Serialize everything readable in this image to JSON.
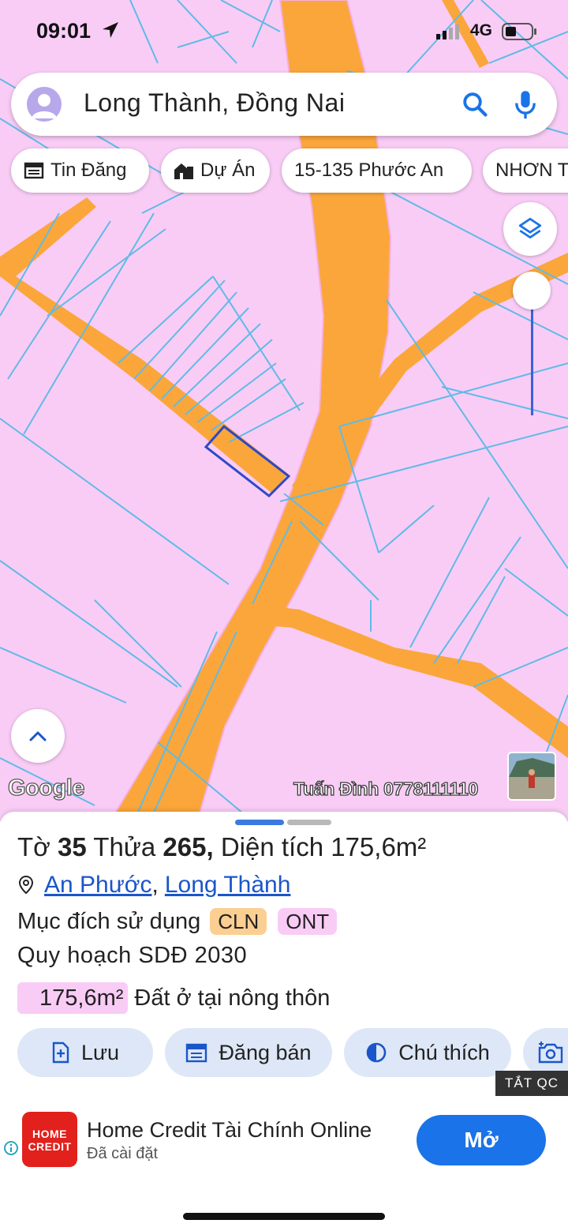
{
  "status_bar": {
    "time": "09:01",
    "network": "4G"
  },
  "search": {
    "text": "Long Thành, Đồng Nai"
  },
  "chips": [
    {
      "label": "Tin Đăng",
      "icon": "news-icon"
    },
    {
      "label": "Dự Án",
      "icon": "building-icon"
    },
    {
      "label": "15-135 Phước An",
      "icon": ""
    },
    {
      "label": "NHƠN T",
      "icon": ""
    }
  ],
  "map": {
    "google_label": "Google",
    "watermark": "Tuấn Đình 0778111110",
    "colors": {
      "residential": "#f9ccf6",
      "road": "#fba63a",
      "parcel_line": "#5fbbe6",
      "selected_parcel": "#2e49c8"
    }
  },
  "sheet": {
    "title_prefix": "Tờ",
    "sheet_no": "35",
    "parcel_label": "Thửa",
    "parcel_no": "265,",
    "area_label": "Diện tích 175,6m²",
    "location_ward": "An Phước",
    "location_separator": ",",
    "location_district": "Long Thành",
    "purpose_label": "Mục đích sử dụng",
    "purpose_codes": [
      "CLN",
      "ONT"
    ],
    "plan_label": "Quy hoạch SDĐ 2030",
    "plan_area": "175,6m²",
    "plan_desc": "Đất ở tại nông thôn"
  },
  "actions": [
    {
      "label": "Lưu",
      "icon": "add-doc-icon"
    },
    {
      "label": "Đăng bán",
      "icon": "calendar-icon"
    },
    {
      "label": "Chú thích",
      "icon": "contrast-icon"
    },
    {
      "label": "",
      "icon": "add-photo-icon"
    }
  ],
  "ad": {
    "close_tag": "TẮT QC",
    "logo_text_1": "HOME",
    "logo_text_2": "CREDIT",
    "title": "Home Credit Tài Chính Online",
    "subtitle": "Đã cài đặt",
    "button": "Mở"
  }
}
